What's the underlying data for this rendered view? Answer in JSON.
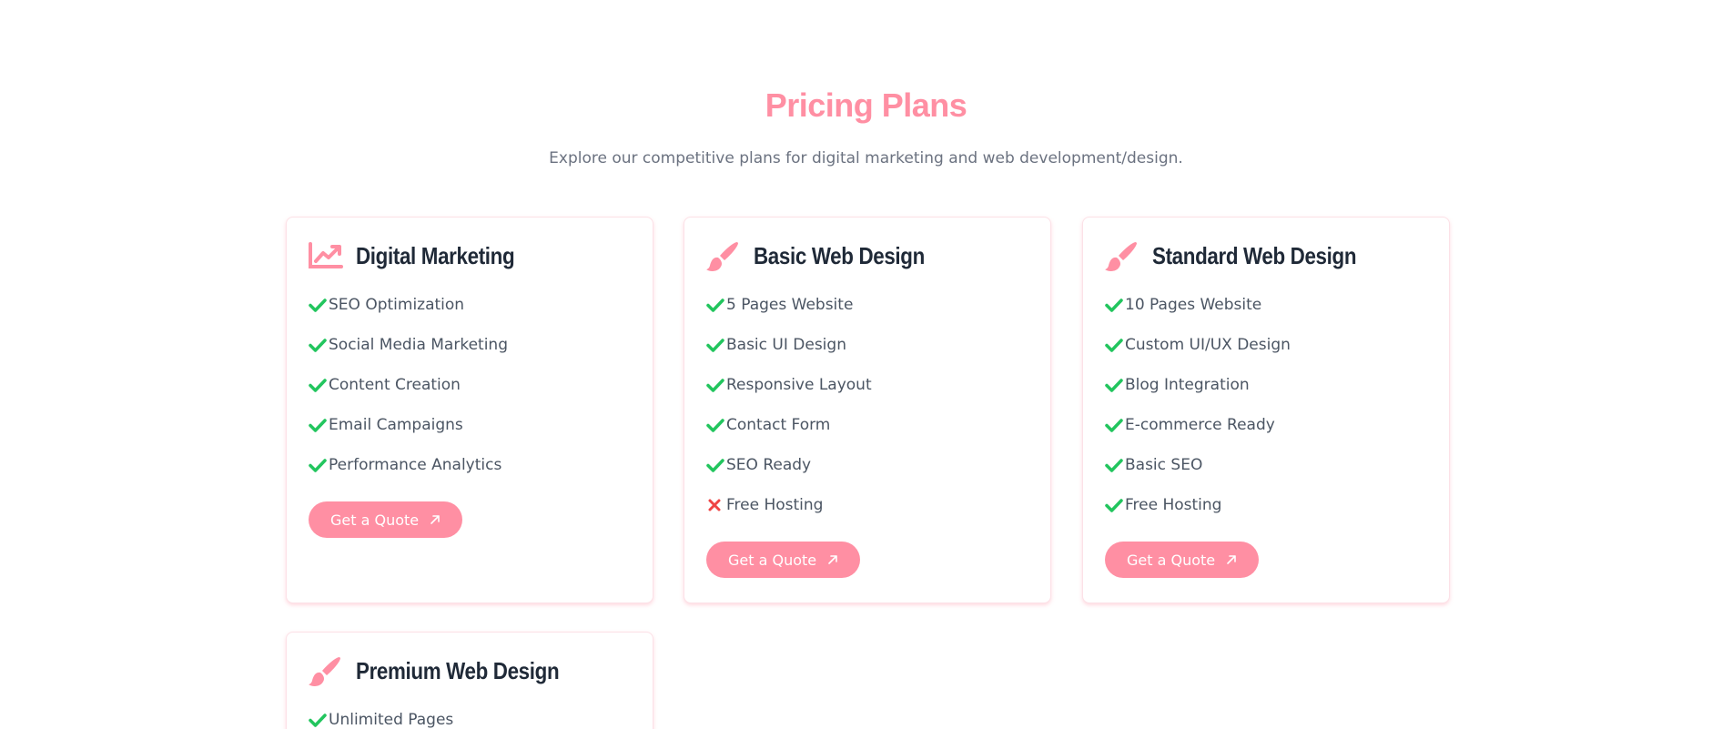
{
  "section": {
    "title": "Pricing Plans",
    "subtitle": "Explore our competitive plans for digital marketing and web development/design."
  },
  "colors": {
    "accent": "#ff8fa3",
    "check": "#22c55e",
    "cross": "#ef4444",
    "heading": "#1f2937",
    "text": "#4b5563"
  },
  "plans": [
    {
      "icon": "chart-line-icon",
      "title": "Digital Marketing",
      "features": [
        {
          "text": "SEO Optimization",
          "included": true
        },
        {
          "text": "Social Media Marketing",
          "included": true
        },
        {
          "text": "Content Creation",
          "included": true
        },
        {
          "text": "Email Campaigns",
          "included": true
        },
        {
          "text": "Performance Analytics",
          "included": true
        }
      ],
      "button_label": "Get a Quote"
    },
    {
      "icon": "paintbrush-icon",
      "title": "Basic Web Design",
      "features": [
        {
          "text": "5 Pages Website",
          "included": true
        },
        {
          "text": "Basic UI Design",
          "included": true
        },
        {
          "text": "Responsive Layout",
          "included": true
        },
        {
          "text": "Contact Form",
          "included": true
        },
        {
          "text": "SEO Ready",
          "included": true
        },
        {
          "text": "Free Hosting",
          "included": false
        }
      ],
      "button_label": "Get a Quote"
    },
    {
      "icon": "paintbrush-icon",
      "title": "Standard Web Design",
      "features": [
        {
          "text": "10 Pages Website",
          "included": true
        },
        {
          "text": "Custom UI/UX Design",
          "included": true
        },
        {
          "text": "Blog Integration",
          "included": true
        },
        {
          "text": "E-commerce Ready",
          "included": true
        },
        {
          "text": "Basic SEO",
          "included": true
        },
        {
          "text": "Free Hosting",
          "included": true
        }
      ],
      "button_label": "Get a Quote"
    },
    {
      "icon": "paintbrush-icon",
      "title": "Premium Web Design",
      "features": [
        {
          "text": "Unlimited Pages",
          "included": true
        }
      ],
      "button_label": ""
    }
  ]
}
